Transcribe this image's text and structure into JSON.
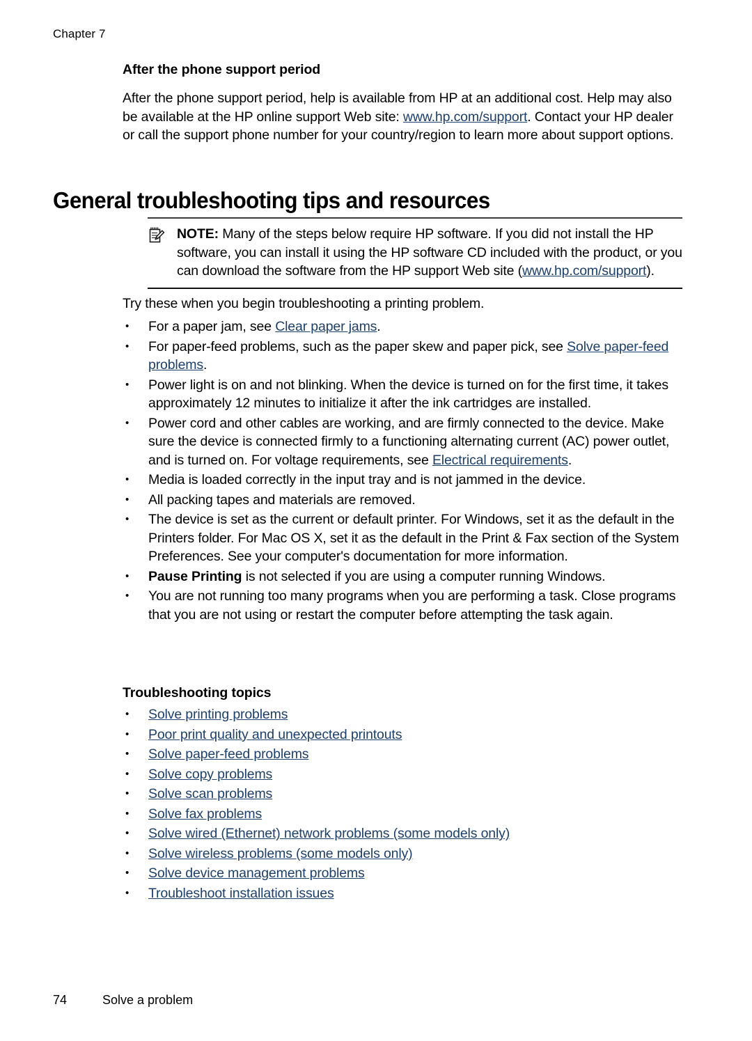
{
  "page": {
    "chapter_label": "Chapter 7",
    "footer_page_number": "74",
    "footer_section": "Solve a problem"
  },
  "colors": {
    "link": "#1d3f6b",
    "text": "#000000",
    "rule": "#111111",
    "background": "#ffffff"
  },
  "subsection": {
    "heading": "After the phone support period",
    "paragraph_part1": "After the phone support period, help is available from HP at an additional cost. Help may also be available at the HP online support Web site: ",
    "paragraph_link": "www.hp.com/support",
    "paragraph_part2": ". Contact your HP dealer or call the support phone number for your country/region to learn more about support options."
  },
  "section": {
    "heading": "General troubleshooting tips and resources",
    "note": {
      "icon": "note-pencil-icon",
      "label": "NOTE:",
      "text_part1": " Many of the steps below require HP software. If you did not install the HP software, you can install it using the HP software CD included with the product, or you can download the software from the HP support Web site (",
      "link": "www.hp.com/support",
      "text_part2": ")."
    },
    "lead_line": "Try these when you begin troubleshooting a printing problem.",
    "bullets": [
      {
        "segments": [
          {
            "type": "text",
            "value": "For a paper jam, see "
          },
          {
            "type": "link",
            "value": "Clear paper jams"
          },
          {
            "type": "text",
            "value": "."
          }
        ]
      },
      {
        "segments": [
          {
            "type": "text",
            "value": "For paper-feed problems, such as the paper skew and paper pick, see "
          },
          {
            "type": "link",
            "value": "Solve paper-feed problems"
          },
          {
            "type": "text",
            "value": "."
          }
        ]
      },
      {
        "segments": [
          {
            "type": "text",
            "value": "Power light is on and not blinking. When the device is turned on for the first time, it takes approximately 12 minutes to initialize it after the ink cartridges are installed."
          }
        ]
      },
      {
        "segments": [
          {
            "type": "text",
            "value": "Power cord and other cables are working, and are firmly connected to the device. Make sure the device is connected firmly to a functioning alternating current (AC) power outlet, and is turned on. For voltage requirements, see "
          },
          {
            "type": "link",
            "value": "Electrical requirements"
          },
          {
            "type": "text",
            "value": "."
          }
        ]
      },
      {
        "segments": [
          {
            "type": "text",
            "value": "Media is loaded correctly in the input tray and is not jammed in the device."
          }
        ]
      },
      {
        "segments": [
          {
            "type": "text",
            "value": "All packing tapes and materials are removed."
          }
        ]
      },
      {
        "segments": [
          {
            "type": "text",
            "value": "The device is set as the current or default printer. For Windows, set it as the default in the Printers folder. For Mac OS X, set it as the default in the Print & Fax section of the System Preferences. See your computer's documentation for more information."
          }
        ]
      },
      {
        "segments": [
          {
            "type": "bold",
            "value": "Pause Printing"
          },
          {
            "type": "text",
            "value": " is not selected if you are using a computer running Windows."
          }
        ]
      },
      {
        "segments": [
          {
            "type": "text",
            "value": "You are not running too many programs when you are performing a task. Close programs that you are not using or restart the computer before attempting the task again."
          }
        ]
      }
    ]
  },
  "topics": {
    "heading": "Troubleshooting topics",
    "links": [
      "Solve printing problems",
      "Poor print quality and unexpected printouts",
      "Solve paper-feed problems",
      "Solve copy problems",
      "Solve scan problems",
      "Solve fax problems",
      "Solve wired (Ethernet) network problems (some models only)",
      "Solve wireless problems (some models only)",
      "Solve device management problems",
      "Troubleshoot installation issues"
    ]
  }
}
